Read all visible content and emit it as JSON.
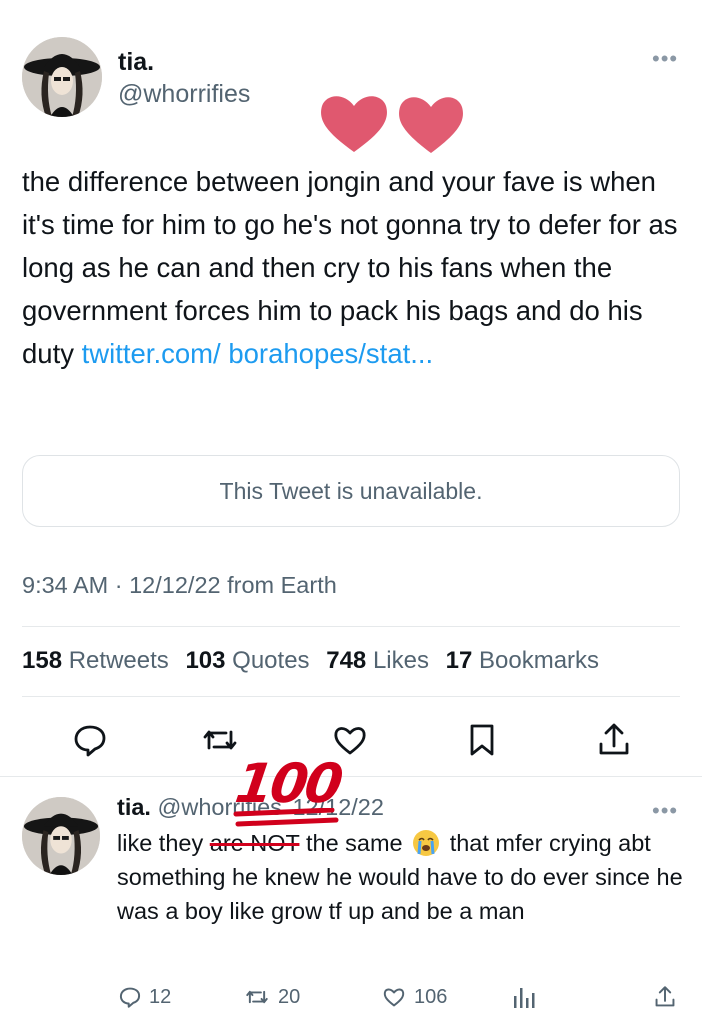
{
  "main_tweet": {
    "author_name": "tia.",
    "author_handle": "@whorrifies",
    "text_before_link": "the difference between jongin and your fave is when it's time for him to go he's not gonna try to defer for as long as he can and then cry to his fans when the government forces him to pack his bags and do his duty ",
    "link_text": "twitter.com/ borahopes/stat...",
    "quoted_tweet": "This Tweet is unavailable.",
    "meta": "9:34 AM · 12/12/22 from Earth",
    "stats": [
      {
        "count": "158",
        "label": "Retweets"
      },
      {
        "count": "103",
        "label": "Quotes"
      },
      {
        "count": "748",
        "label": "Likes"
      },
      {
        "count": "17",
        "label": "Bookmarks"
      }
    ],
    "actions": [
      "reply-icon",
      "retweet-icon",
      "like-icon",
      "bookmark-icon",
      "share-icon"
    ]
  },
  "reply_tweet": {
    "author_name": "tia.",
    "author_handle": "@whorrifies",
    "date": "12/12/22",
    "text_part1": "like they ",
    "text_strike": "are NOT",
    "text_part2": " the same ",
    "text_part3": " that mfer crying abt something he knew he would have to do ever since he was a boy like grow tf up and be a man",
    "reply_count": "12",
    "retweet_count": "20",
    "like_count": "106"
  },
  "stickers": {
    "hundred": "100"
  },
  "colors": {
    "link": "#1d9bf0",
    "secondary_text": "#536471",
    "heart_sticker": "#e0586f",
    "hundred_red": "#d1001c"
  }
}
